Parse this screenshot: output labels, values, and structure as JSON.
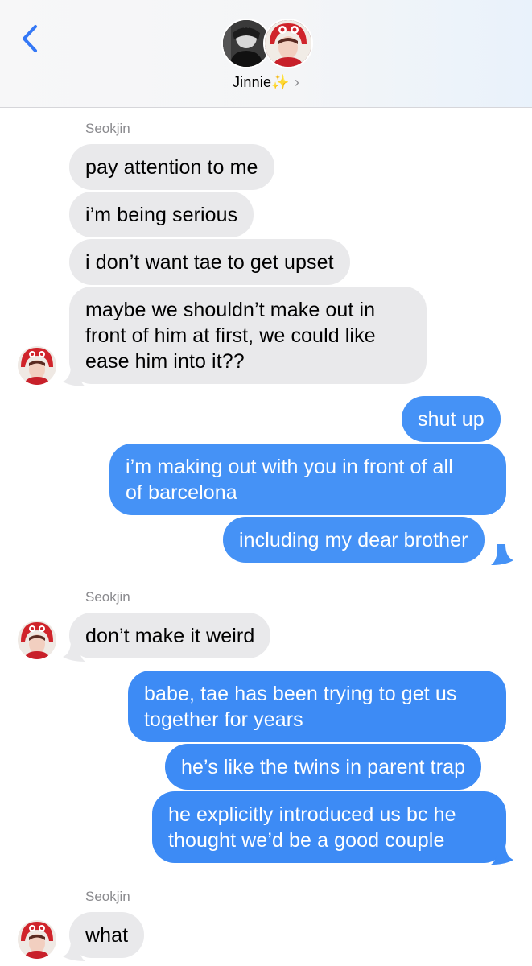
{
  "header": {
    "contact_name": "Jinnie",
    "contact_emoji": "✨",
    "chevron": "›",
    "back_icon": "chevron-left-icon"
  },
  "conversation": {
    "sender_name": "Seokjin",
    "incoming_group_1": [
      "pay attention to me",
      "i’m being serious",
      "i don’t want tae to get upset",
      "maybe we shouldn’t make out in",
      "front of him at first, we could like",
      "ease him into it??"
    ],
    "outgoing_group_1": [
      "shut up",
      "i’m making out with you in front of all",
      "of barcelona",
      "including my dear brother"
    ],
    "incoming_group_2": [
      "don’t make it weird"
    ],
    "outgoing_group_2": [
      "babe, tae has been trying to get us",
      "together for years",
      "he’s like the twins in parent trap",
      "he explicitly introduced us bc he",
      "thought we’d be a good couple"
    ],
    "incoming_group_3": [
      "what"
    ]
  },
  "colors": {
    "incoming_bubble": "#e9e9eb",
    "outgoing_bubble": "#3d8bf5",
    "accent_blue": "#3478f6"
  }
}
